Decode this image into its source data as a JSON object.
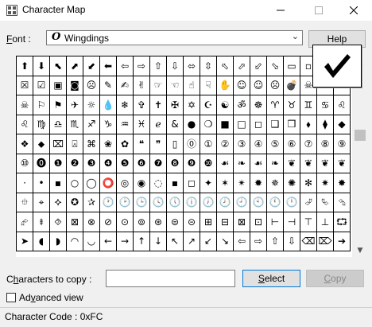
{
  "window": {
    "title": "Character Map"
  },
  "font": {
    "label": "Font :",
    "label_accel": "F",
    "label_rest": "ont :",
    "icon": "O",
    "selected": "Wingdings"
  },
  "help_label": "Help",
  "grid": {
    "rows": [
      [
        "⬆",
        "⬇",
        "⬉",
        "⬈",
        "⬋",
        "⬅",
        "⇦",
        "⇨",
        "⇧",
        "⇩",
        "⬄",
        "⇳",
        "⬁",
        "⬀",
        "⬃",
        "⬂",
        "▭",
        "▫",
        "✗",
        "✓"
      ],
      [
        "☒",
        "☑",
        "▣",
        "◙",
        "☹",
        "✎",
        "✍",
        "✌",
        "☞",
        "☜",
        "☝",
        "☟",
        "✋",
        "☺",
        "☺",
        "☹",
        "💣",
        "☠",
        "⚐",
        "⚑"
      ],
      [
        "☠",
        "⚐",
        "⚑",
        "✈",
        "☼",
        "💧",
        "❄",
        "✞",
        "✝",
        "✠",
        "✡",
        "☪",
        "☯",
        "ॐ",
        "☸",
        "♈",
        "♉",
        "♊",
        "♋",
        "♌"
      ],
      [
        "♌",
        "♍",
        "♎",
        "♏",
        "♐",
        "♑",
        "♒",
        "♓",
        "ℯ",
        "&",
        "●",
        "❍",
        "■",
        "□",
        "◻",
        "❑",
        "❒",
        "⬧",
        "⧫",
        "◆"
      ],
      [
        "❖",
        "⬥",
        "⌧",
        "⍓",
        "⌘",
        "❀",
        "✿",
        "❝",
        "❞",
        "▯",
        "⓪",
        "①",
        "②",
        "③",
        "④",
        "⑤",
        "⑥",
        "⑦",
        "⑧",
        "⑨"
      ],
      [
        "⑩",
        "⓿",
        "❶",
        "❷",
        "❸",
        "❹",
        "❺",
        "❻",
        "❼",
        "❽",
        "❾",
        "❿",
        "☙",
        "❧",
        "☙",
        "❧",
        "❦",
        "❦",
        "❦",
        "❦"
      ],
      [
        "·",
        "•",
        "▪",
        "○",
        "◯",
        "⭕",
        "◎",
        "◉",
        "◌",
        "▪",
        "◻",
        "✦",
        "✶",
        "✴",
        "✹",
        "✵",
        "✺",
        "✻",
        "✷",
        "✸"
      ],
      [
        "⯐",
        "⌖",
        "⯎",
        "✪",
        "✰",
        "🕐",
        "🕑",
        "🕒",
        "🕓",
        "🕔",
        "🕕",
        "🕖",
        "🕗",
        "🕘",
        "🕙",
        "🕚",
        "🕛",
        "⮰",
        "⮱",
        "⮲"
      ],
      [
        "⮳",
        "⯒",
        "⯑",
        "⊠",
        "⊗",
        "⊘",
        "⊙",
        "⊚",
        "⊛",
        "⊜",
        "⊝",
        "⊞",
        "⊟",
        "⊠",
        "⊡",
        "⊢",
        "⊣",
        "⊤",
        "⊥",
        "⮔"
      ],
      [
        "➤",
        "◖",
        "◗",
        "◠",
        "◡",
        "←",
        "→",
        "↑",
        "↓",
        "↖",
        "↗",
        "↙",
        "↘",
        "⇦",
        "⇨",
        "⇧",
        "⇩",
        "⌫",
        "⌦",
        "➔"
      ]
    ]
  },
  "magnified_char": "✓",
  "copy": {
    "label": "Characters to copy :",
    "label_accel_before": "C",
    "label_accel": "h",
    "label_rest": "aracters to copy :",
    "value": ""
  },
  "buttons": {
    "select": "Select",
    "select_accel": "S",
    "select_rest": "elect",
    "copy": "Copy",
    "copy_accel": "C",
    "copy_rest": "opy"
  },
  "advanced": {
    "label": "Advanced view",
    "accel": "v",
    "before": "Ad",
    "after": "anced view",
    "checked": false
  },
  "status": {
    "text": "Character Code : 0xFC"
  },
  "colors": {
    "select_border": "#0078d7",
    "disabled_text": "#8a8a8a"
  }
}
